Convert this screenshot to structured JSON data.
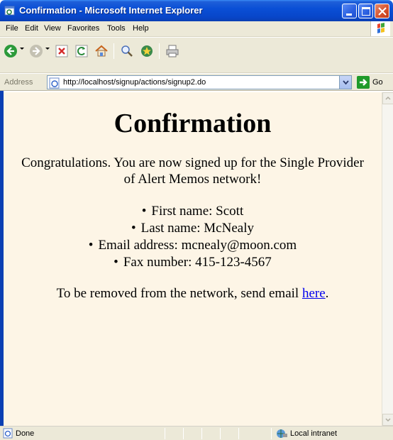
{
  "window": {
    "title": "Confirmation - Microsoft Internet Explorer"
  },
  "menu": {
    "items": [
      "File",
      "Edit",
      "View",
      "Favorites",
      "Tools",
      "Help"
    ]
  },
  "address": {
    "label": "Address",
    "url": "http://localhost/signup/actions/signup2.do",
    "go_label": "Go"
  },
  "page": {
    "heading": "Confirmation",
    "intro": "Congratulations. You are now signed up for the Single Provider of Alert Memos network!",
    "details": [
      "First name: Scott",
      "Last name: McNealy",
      "Email address: mcnealy@moon.com",
      "Fax number: 415-123-4567"
    ],
    "remove_text": "To be removed from the network, send email ",
    "remove_link": "here",
    "remove_suffix": ".",
    "background": "#fdf5e6"
  },
  "status": {
    "text": "Done",
    "zone": "Local intranet"
  }
}
